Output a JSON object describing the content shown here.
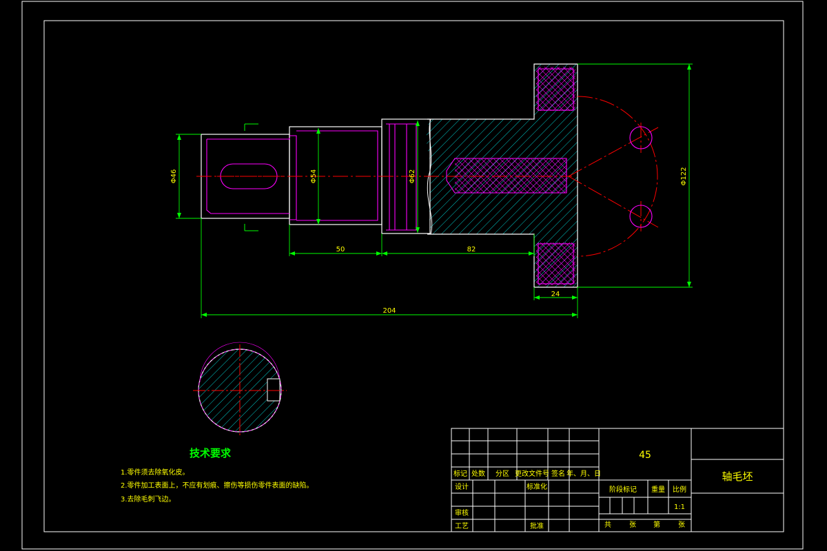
{
  "dimensions": {
    "dia_46": "Φ46",
    "dia_54": "Φ54",
    "dia_62": "Φ62",
    "dia_122": "Φ122",
    "len_50": "50",
    "len_82": "82",
    "len_24": "24",
    "len_204": "204"
  },
  "tech_requirements": {
    "title": "技术要求",
    "items": [
      "1.零件须去除氧化皮。",
      "2.零件加工表面上，不应有划痕、擦伤等损伤零件表面的缺陷。",
      "3.去除毛刺飞边。"
    ]
  },
  "title_block": {
    "material": "45",
    "part_name": "轴毛坯",
    "scale": "1:1",
    "headers": {
      "mark": "标记",
      "count": "处数",
      "zone": "分区",
      "change_doc": "更改文件号",
      "signature": "签名",
      "date": "年、月、日",
      "design": "设计",
      "standardize": "标准化",
      "stage_mark": "阶段标记",
      "weight": "重量",
      "ratio": "比例",
      "review": "审核",
      "process": "工艺",
      "approve": "批准",
      "total": "共",
      "sheets1": "张",
      "sheet_no": "第",
      "sheets2": "张"
    }
  },
  "colors": {
    "background": "#000000",
    "border": "#ffffff",
    "outline": "#ffffff",
    "hidden_lines": "#ff00ff",
    "hatch": "#00ffff",
    "centerline": "#ff0000",
    "dimension": "#00ff00",
    "text_yellow": "#ffff00",
    "text_green": "#00ff00"
  }
}
